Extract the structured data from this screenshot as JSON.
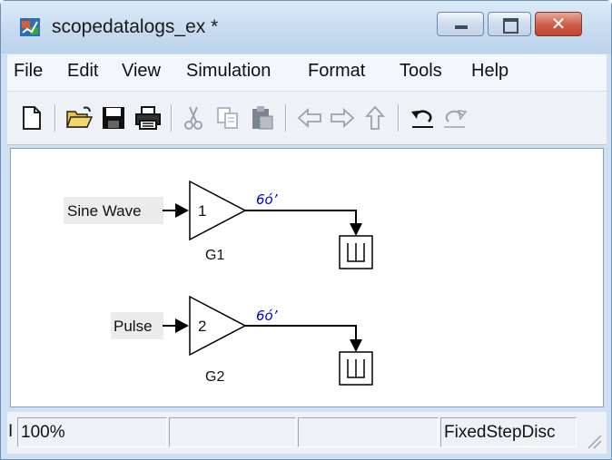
{
  "window": {
    "title": "scopedatalogs_ex *",
    "minimize_icon": "minimize-icon",
    "maximize_icon": "maximize-icon",
    "close_glyph": "✕"
  },
  "menu": {
    "items": [
      "File",
      "Edit",
      "View",
      "Simulation",
      "Format",
      "Tools",
      "Help"
    ]
  },
  "toolbar": {
    "icons": [
      "new-file-icon",
      "open-folder-icon",
      "save-icon",
      "print-icon",
      "cut-icon",
      "copy-icon",
      "paste-icon",
      "back-arrow-icon",
      "forward-arrow-icon",
      "up-arrow-icon",
      "undo-icon",
      "redo-icon"
    ]
  },
  "diagram": {
    "row1": {
      "source": "Sine Wave",
      "gain": "1",
      "gain_label": "G1",
      "signal_log_glyph": "6ó’"
    },
    "row2": {
      "source": "Pulse",
      "gain": "2",
      "gain_label": "G2",
      "signal_log_glyph": "6ó’"
    }
  },
  "status": {
    "left_fragment": "I",
    "zoom": "100%",
    "cell2": "",
    "cell3": "",
    "solver": "FixedStepDisc"
  },
  "colors": {
    "accent_blue": "#0000c8",
    "close_red": "#c24431"
  }
}
